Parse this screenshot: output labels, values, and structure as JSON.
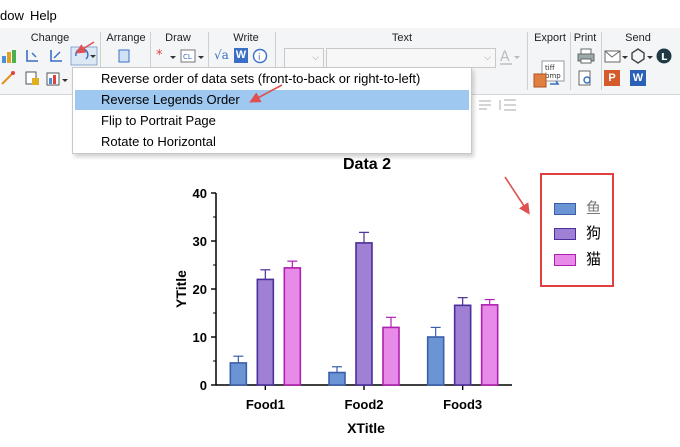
{
  "menubar": {
    "items": [
      "dow",
      "Help"
    ]
  },
  "ribbon": {
    "groups": {
      "change": "Change",
      "arrange": "Arrange",
      "draw": "Draw",
      "write": "Write",
      "text": "Text",
      "export": "Export",
      "print": "Print",
      "send": "Send"
    },
    "write_icons": {
      "formula": "√a",
      "word": "W"
    },
    "export_icon": "tiff bmp"
  },
  "dropdown": {
    "items": [
      "Reverse order of data sets (front-to-back or right-to-left)",
      "Reverse Legends Order",
      "Flip to Portrait Page",
      "Rotate to Horizontal"
    ],
    "highlighted_index": 1
  },
  "chart_data": {
    "type": "bar",
    "title": "Data 2",
    "xlabel": "XTitle",
    "ylabel": "YTitle",
    "categories": [
      "Food1",
      "Food2",
      "Food3"
    ],
    "ylim": [
      0,
      40
    ],
    "yticks": [
      "0",
      "10",
      "20",
      "30",
      "40"
    ],
    "series": [
      {
        "name": "鱼",
        "values": [
          4.6,
          2.6,
          10.0
        ],
        "errors": [
          1.4,
          1.2,
          2.0
        ],
        "color": "#6b94d4",
        "stroke": "#3b5fa8"
      },
      {
        "name": "狗",
        "values": [
          22.0,
          29.6,
          16.6
        ],
        "errors": [
          2.0,
          2.2,
          1.6
        ],
        "color": "#9f80d4",
        "stroke": "#4b2f9a"
      },
      {
        "name": "猫",
        "values": [
          24.4,
          12.0,
          16.7
        ],
        "errors": [
          1.4,
          2.1,
          1.1
        ],
        "color": "#e88ae8",
        "stroke": "#b020b0"
      }
    ],
    "legend_position": "right"
  },
  "colors": {
    "annotation_arrow": "#e05050",
    "legend_border": "#e04040",
    "highlight": "#9ec8f0"
  }
}
